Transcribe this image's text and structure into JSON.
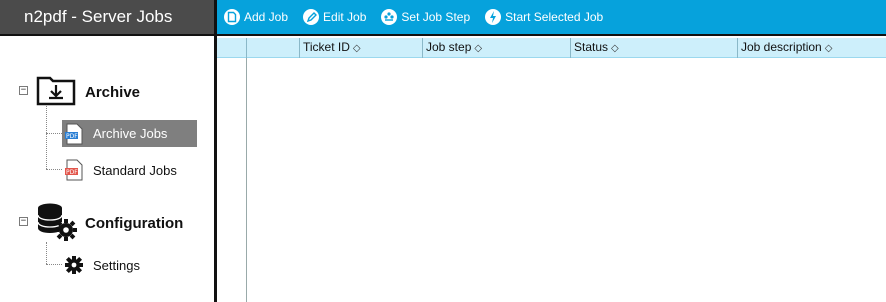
{
  "app": {
    "title": "n2pdf - Server Jobs"
  },
  "toolbar": {
    "buttons": [
      {
        "label": "Add Job",
        "icon": "add-job-icon"
      },
      {
        "label": "Edit Job",
        "icon": "edit-job-icon"
      },
      {
        "label": "Set Job Step",
        "icon": "set-job-step-icon"
      },
      {
        "label": "Start Selected Job",
        "icon": "start-job-icon"
      }
    ]
  },
  "sidebar": {
    "groups": [
      {
        "label": "Archive",
        "toggle": "⊟",
        "icon": "archive-folder-icon",
        "items": [
          {
            "label": "Archive Jobs",
            "icon": "pdf-icon",
            "selected": true
          },
          {
            "label": "Standard Jobs",
            "icon": "pdf-icon",
            "selected": false
          }
        ]
      },
      {
        "label": "Configuration",
        "toggle": "⊟",
        "icon": "database-gear-icon",
        "items": [
          {
            "label": "Settings",
            "icon": "gear-icon",
            "selected": false
          }
        ]
      }
    ]
  },
  "grid": {
    "columns": [
      {
        "label": "Ticket ID",
        "sort_icon": "◇"
      },
      {
        "label": "Job step",
        "sort_icon": "◇"
      },
      {
        "label": "Status",
        "sort_icon": "◇"
      },
      {
        "label": "Job description",
        "sort_icon": "◇"
      }
    ],
    "rows": []
  },
  "colors": {
    "toolbar": "#06a2dc",
    "header_dark": "#4b4b4b",
    "grid_header": "#cdeffb",
    "selection": "#7f7f7f"
  }
}
